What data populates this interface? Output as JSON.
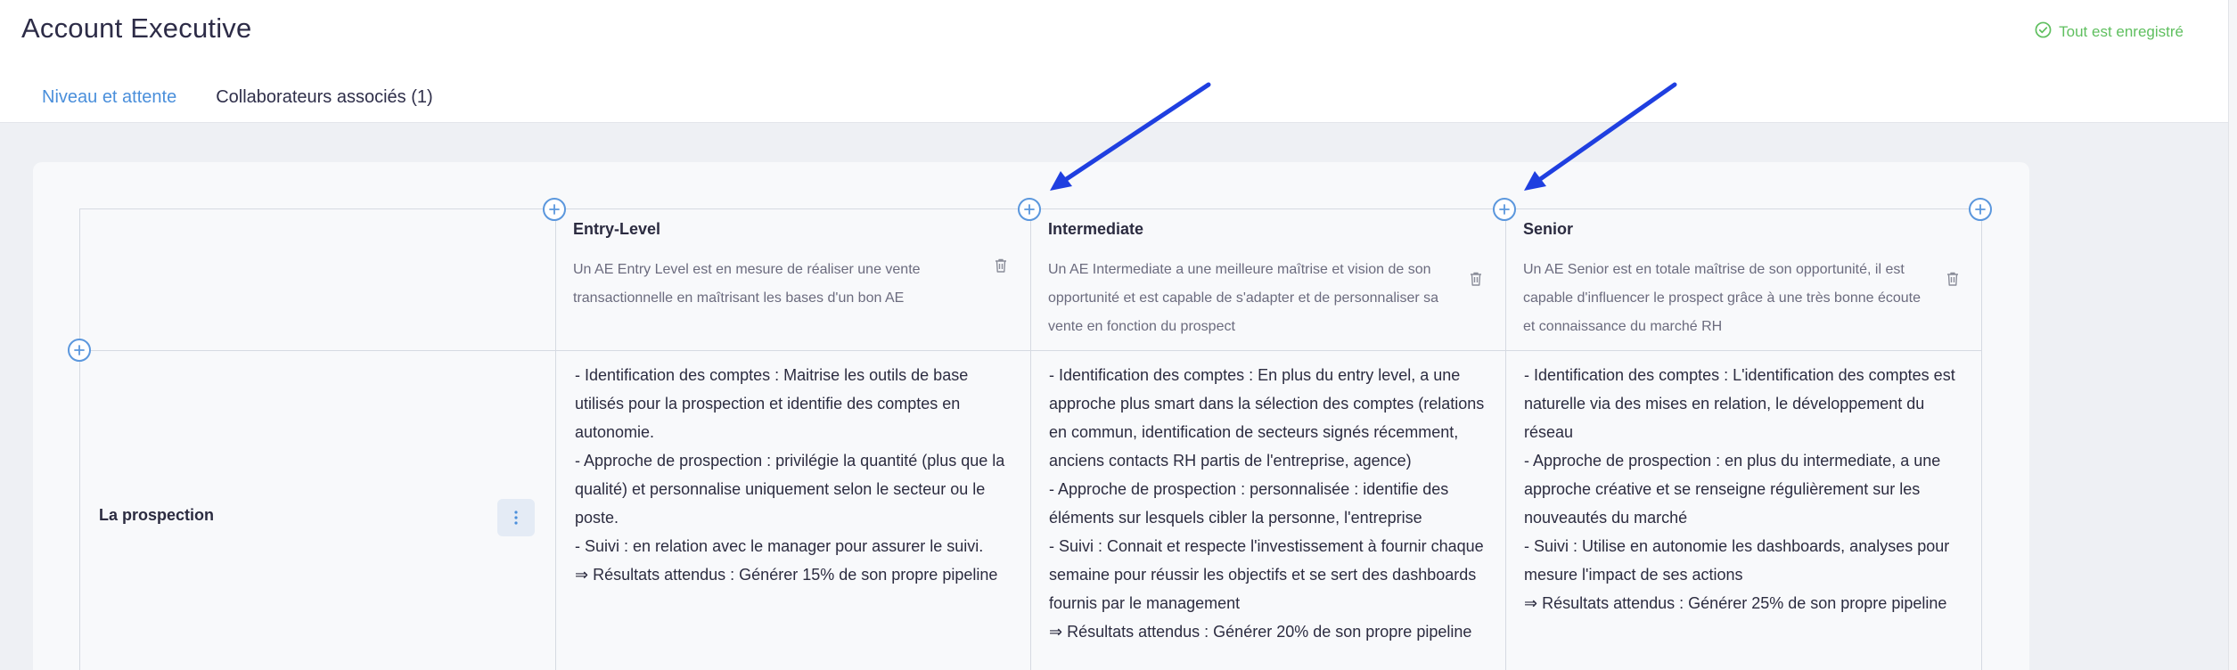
{
  "header": {
    "title": "Account Executive",
    "saved_status": "Tout est enregistré",
    "tabs": [
      {
        "label": "Niveau et attente",
        "active": true
      },
      {
        "label": "Collaborateurs associés (1)",
        "active": false
      }
    ]
  },
  "levels": [
    {
      "title": "Entry-Level",
      "description": "Un AE Entry Level est en mesure de réaliser une vente transactionnelle en maîtrisant les bases d'un bon AE"
    },
    {
      "title": "Intermediate",
      "description": "Un AE Intermediate a une meilleure maîtrise et vision de son opportunité et est capable de s'adapter et de personnaliser sa vente en fonction du prospect"
    },
    {
      "title": "Senior",
      "description": "Un AE Senior est en totale maîtrise de son opportunité, il est capable d'influencer le prospect grâce à une très bonne écoute et connaissance du marché RH"
    }
  ],
  "rows": [
    {
      "label": "La prospection",
      "cells": [
        "- Identification des comptes : Maitrise les outils de base utilisés pour la prospection et identifie des comptes en autonomie.\n- Approche de prospection : privilégie la quantité (plus que la qualité) et personnalise uniquement selon le secteur ou le poste.\n- Suivi : en relation avec le manager pour assurer le suivi.\n⇒ Résultats attendus : Générer 15% de son propre pipeline",
        "- Identification des comptes : En plus du entry level, a une approche plus smart dans la sélection des comptes (relations en commun, identification de secteurs signés récemment, anciens contacts RH partis de l'entreprise, agence)\n- Approche de prospection : personnalisée : identifie des éléments sur lesquels cibler la personne, l'entreprise\n- Suivi : Connait et respecte l'investissement à fournir chaque semaine pour réussir les objectifs et se sert des dashboards fournis par le management\n⇒ Résultats attendus : Générer 20% de son propre pipeline",
        "- Identification des comptes : L'identification des comptes est naturelle via des mises en relation, le développement du réseau\n- Approche de prospection : en plus du intermediate, a une approche créative et se renseigne régulièrement sur les nouveautés du marché\n- Suivi : Utilise en autonomie les dashboards, analyses pour mesure l'impact de ses actions\n⇒ Résultats attendus : Générer 25% de son propre pipeline"
      ]
    }
  ],
  "icons": {
    "saved": "check-circle-icon",
    "add": "plus-circle-icon",
    "delete": "trash-icon",
    "menu": "kebab-menu-icon",
    "annotation": "arrow-icon"
  },
  "colors": {
    "accent": "#4a8fdb",
    "success": "#5fbf5f",
    "annotation_arrow": "#1f3fe0"
  }
}
